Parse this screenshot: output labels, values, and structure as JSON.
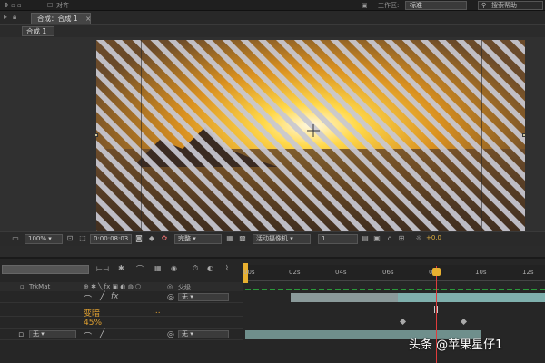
{
  "topbar": {
    "align_label": "对齐",
    "workspace_label": "工作区:",
    "workspace_value": "标准",
    "search_placeholder": "搜索帮助"
  },
  "tabs": {
    "comp_tab": "合成：合成 1",
    "breadcrumb": "合成 1"
  },
  "viewer_toolbar": {
    "zoom": "100%",
    "timecode": "0:00:08:03",
    "resolution": "完整",
    "camera": "活动摄像机",
    "views": "1 ...",
    "exposure": "+0.0"
  },
  "timeline": {
    "ruler_ticks": [
      "00s",
      "02s",
      "04s",
      "06s",
      "08s",
      "10s",
      "12s"
    ],
    "columns": {
      "trkmat": "TrkMat",
      "parent": "父级"
    },
    "layers": [
      {
        "parent": "无"
      },
      {
        "trkmat": "无",
        "parent": "无"
      }
    ],
    "property": {
      "name": "变暗",
      "link": "...",
      "value": "45%"
    }
  },
  "watermark": "头条 @苹果星仔1",
  "colors": {
    "accent": "#e8b030",
    "playhead": "#e03c3c",
    "layer_bar": "#6f8f8c"
  }
}
